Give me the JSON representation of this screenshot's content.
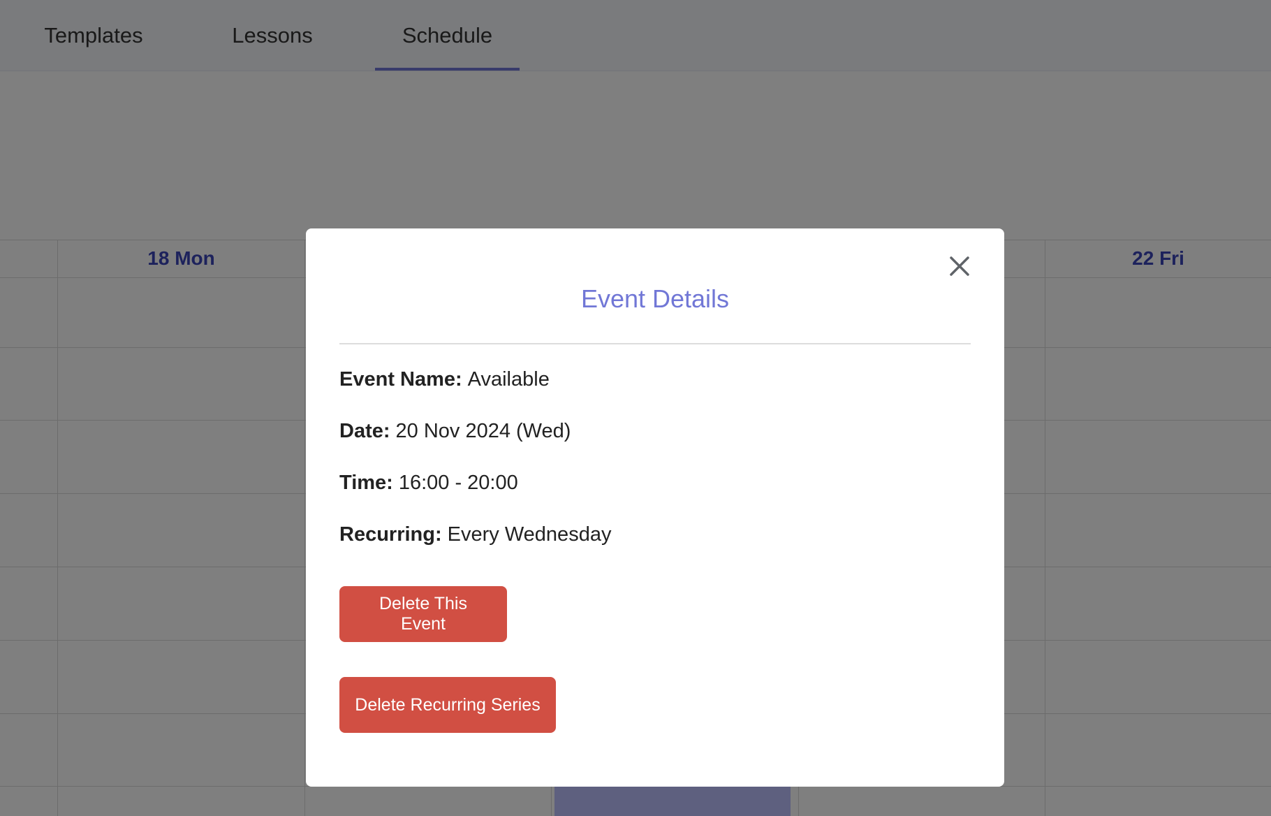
{
  "nav": {
    "tabs": [
      {
        "label": "Templates"
      },
      {
        "label": "Lessons"
      },
      {
        "label": "Schedule",
        "active": true
      }
    ]
  },
  "calendar": {
    "day_headers": [
      "18 Mon",
      "22 Fri"
    ]
  },
  "modal": {
    "title": "Event Details",
    "fields": [
      {
        "label": "Event Name:",
        "value": "Available"
      },
      {
        "label": "Date:",
        "value": "20 Nov 2024 (Wed)"
      },
      {
        "label": "Time:",
        "value": "16:00 - 20:00"
      },
      {
        "label": "Recurring:",
        "value": "Every Wednesday"
      }
    ],
    "buttons": {
      "delete_event": "Delete This Event",
      "delete_series": "Delete Recurring Series"
    }
  },
  "colors": {
    "accent": "#7177d6",
    "day_header": "#3a44b8",
    "danger": "#d14f43",
    "event_block": "#bcc0ff"
  },
  "icons": {
    "close": "close-icon"
  }
}
